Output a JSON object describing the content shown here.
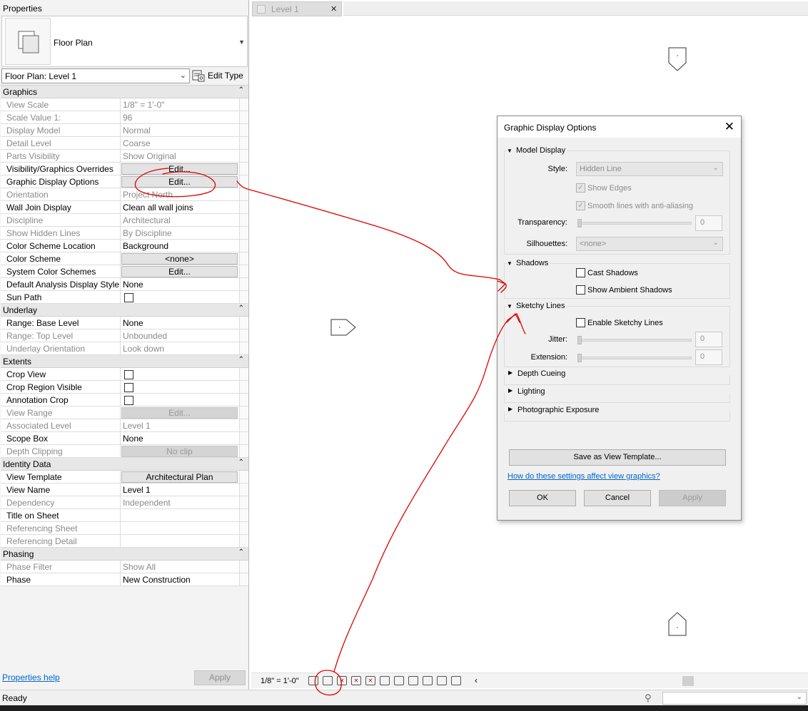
{
  "properties": {
    "title": "Properties",
    "type_name": "Floor Plan",
    "selector": "Floor Plan: Level 1",
    "edit_type": "Edit Type",
    "help_link": "Properties help",
    "apply": "Apply",
    "sections": [
      {
        "name": "Graphics",
        "rows": [
          {
            "key": "View Scale",
            "value": "1/8\" = 1'-0\"",
            "kind": "text",
            "disabled": true
          },
          {
            "key": "Scale Value    1:",
            "value": "96",
            "kind": "text",
            "disabled": true
          },
          {
            "key": "Display Model",
            "value": "Normal",
            "kind": "text",
            "disabled": true
          },
          {
            "key": "Detail Level",
            "value": "Coarse",
            "kind": "text",
            "disabled": true
          },
          {
            "key": "Parts Visibility",
            "value": "Show Original",
            "kind": "text",
            "disabled": true
          },
          {
            "key": "Visibility/Graphics Overrides",
            "value": "Edit...",
            "kind": "button",
            "disabled": false
          },
          {
            "key": "Graphic Display Options",
            "value": "Edit...",
            "kind": "button",
            "disabled": false
          },
          {
            "key": "Orientation",
            "value": "Project North",
            "kind": "text",
            "disabled": true
          },
          {
            "key": "Wall Join Display",
            "value": "Clean all wall joins",
            "kind": "text",
            "disabled": false
          },
          {
            "key": "Discipline",
            "value": "Architectural",
            "kind": "text",
            "disabled": true
          },
          {
            "key": "Show Hidden Lines",
            "value": "By Discipline",
            "kind": "text",
            "disabled": true
          },
          {
            "key": "Color Scheme Location",
            "value": "Background",
            "kind": "text",
            "disabled": false
          },
          {
            "key": "Color Scheme",
            "value": "<none>",
            "kind": "button",
            "disabled": false
          },
          {
            "key": "System Color Schemes",
            "value": "Edit...",
            "kind": "button",
            "disabled": false
          },
          {
            "key": "Default Analysis Display Style",
            "value": "None",
            "kind": "text",
            "disabled": false
          },
          {
            "key": "Sun Path",
            "value": "",
            "kind": "checkbox",
            "disabled": false
          }
        ]
      },
      {
        "name": "Underlay",
        "rows": [
          {
            "key": "Range: Base Level",
            "value": "None",
            "kind": "text",
            "disabled": false
          },
          {
            "key": "Range: Top Level",
            "value": "Unbounded",
            "kind": "text",
            "disabled": true
          },
          {
            "key": "Underlay Orientation",
            "value": "Look down",
            "kind": "text",
            "disabled": true
          }
        ]
      },
      {
        "name": "Extents",
        "rows": [
          {
            "key": "Crop View",
            "value": "",
            "kind": "checkbox",
            "disabled": false
          },
          {
            "key": "Crop Region Visible",
            "value": "",
            "kind": "checkbox",
            "disabled": false
          },
          {
            "key": "Annotation Crop",
            "value": "",
            "kind": "checkbox",
            "disabled": false
          },
          {
            "key": "View Range",
            "value": "Edit...",
            "kind": "button",
            "disabled": true
          },
          {
            "key": "Associated Level",
            "value": "Level 1",
            "kind": "text",
            "disabled": true
          },
          {
            "key": "Scope Box",
            "value": "None",
            "kind": "text",
            "disabled": false
          },
          {
            "key": "Depth Clipping",
            "value": "No clip",
            "kind": "button",
            "disabled": true
          }
        ]
      },
      {
        "name": "Identity Data",
        "rows": [
          {
            "key": "View Template",
            "value": "Architectural Plan",
            "kind": "button",
            "disabled": false
          },
          {
            "key": "View Name",
            "value": "Level 1",
            "kind": "text",
            "disabled": false
          },
          {
            "key": "Dependency",
            "value": "Independent",
            "kind": "text",
            "disabled": true
          },
          {
            "key": "Title on Sheet",
            "value": "",
            "kind": "text",
            "disabled": false
          },
          {
            "key": "Referencing Sheet",
            "value": "",
            "kind": "text",
            "disabled": true
          },
          {
            "key": "Referencing Detail",
            "value": "",
            "kind": "text",
            "disabled": true
          }
        ]
      },
      {
        "name": "Phasing",
        "rows": [
          {
            "key": "Phase Filter",
            "value": "Show All",
            "kind": "text",
            "disabled": true
          },
          {
            "key": "Phase",
            "value": "New Construction",
            "kind": "text",
            "disabled": false
          }
        ]
      }
    ]
  },
  "view": {
    "tab_label": "Level 1",
    "scale": "1/8\" = 1'-0\""
  },
  "status": {
    "text": "Ready"
  },
  "dialog": {
    "title": "Graphic Display Options",
    "model_display": {
      "header": "Model Display",
      "style_label": "Style:",
      "style_value": "Hidden Line",
      "show_edges": "Show Edges",
      "smooth_lines": "Smooth lines with anti-aliasing",
      "transparency_label": "Transparency:",
      "transparency_value": "0",
      "silhouettes_label": "Silhouettes:",
      "silhouettes_value": "<none>"
    },
    "shadows": {
      "header": "Shadows",
      "cast": "Cast Shadows",
      "ambient": "Show Ambient Shadows"
    },
    "sketchy": {
      "header": "Sketchy Lines",
      "enable": "Enable Sketchy Lines",
      "jitter_label": "Jitter:",
      "jitter_value": "0",
      "extension_label": "Extension:",
      "extension_value": "0"
    },
    "depth_cueing": "Depth Cueing",
    "lighting": "Lighting",
    "photographic": "Photographic Exposure",
    "save_template": "Save as View Template...",
    "help_link": "How do these settings affect view graphics?",
    "ok": "OK",
    "cancel": "Cancel",
    "apply": "Apply"
  },
  "annotation_color": "#e00000"
}
